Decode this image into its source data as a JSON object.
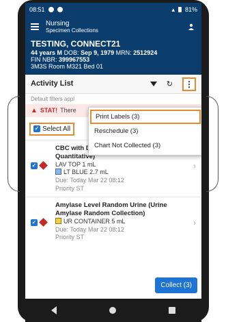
{
  "status_bar": {
    "time": "08:51",
    "battery": "81%"
  },
  "app_header": {
    "section": "Nursing",
    "subtitle": "Specimen Collections"
  },
  "patient": {
    "name": "TESTING, CONNECT21",
    "age_sex": "44 years M",
    "dob_label": "DOB:",
    "dob": "Sep 9, 1979",
    "mrn_label": "MRN:",
    "mrn": "2512924",
    "fin_label": "FIN NBR:",
    "fin": "399967553",
    "location": "3M3S Room M321 Bed 01"
  },
  "toolbar": {
    "title": "Activity List",
    "more_glyph": "⋮",
    "refresh_glyph": "↻"
  },
  "filters_note": "Default filters appl",
  "stat_banner": {
    "icon_glyph": "▲",
    "label": "STAT!",
    "text": "There"
  },
  "select_all": {
    "label": "Select All",
    "checked": true
  },
  "menu": {
    "items": [
      {
        "label": "Print Labels (3)",
        "highlighted": true
      },
      {
        "label": "Reschedule (3)",
        "highlighted": false
      },
      {
        "label": "Chart Not Collected (3)",
        "highlighted": false
      }
    ]
  },
  "activities": [
    {
      "name": "CBC with Differential, D-Dimer (D Dimer, Quantitative)",
      "container1": "LAV TOP 1 mL",
      "container2": "LT BLUE 2.7 mL",
      "due": "Due: Today Mar 22 08:12",
      "priority": "Priority  ST",
      "checked": true
    },
    {
      "name": "Amylase Level Random Urine (Urine Amylase Random Collection)",
      "container1": "UR CONTAINER 5 mL",
      "due": "Due: Today Mar 22 08:12",
      "priority": "Priority  ST",
      "checked": true
    }
  ],
  "collect_button": "Collect (3)",
  "colors": {
    "header_bg": "#0a3d6b",
    "accent_blue": "#1e73d6",
    "highlight_orange": "#e58a2e",
    "stat_red": "#c62828"
  }
}
